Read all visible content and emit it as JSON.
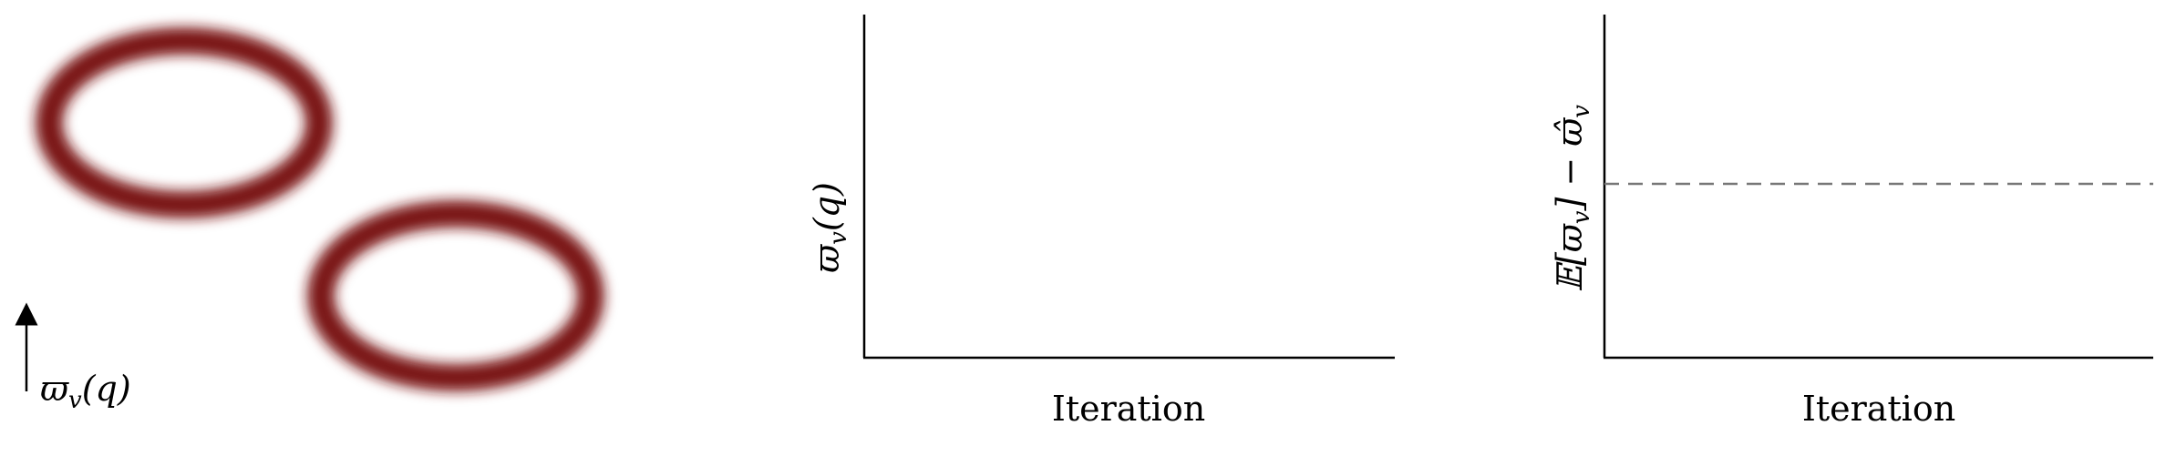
{
  "left_panel": {
    "ring_color": "#7a1414",
    "axis_label": "ϖ",
    "axis_label_sub": "v",
    "axis_label_suffix": "(q)"
  },
  "middle_plot": {
    "ylabel": "ϖ",
    "ylabel_sub": "v",
    "ylabel_suffix": "(q)",
    "xlabel": "Iteration"
  },
  "right_plot": {
    "ylabel_prefix": "𝔼[ϖ",
    "ylabel_sub": "v",
    "ylabel_mid": "] − ϖ̂",
    "ylabel_sub2": "v",
    "xlabel": "Iteration",
    "dashed_line_color": "#777777"
  }
}
